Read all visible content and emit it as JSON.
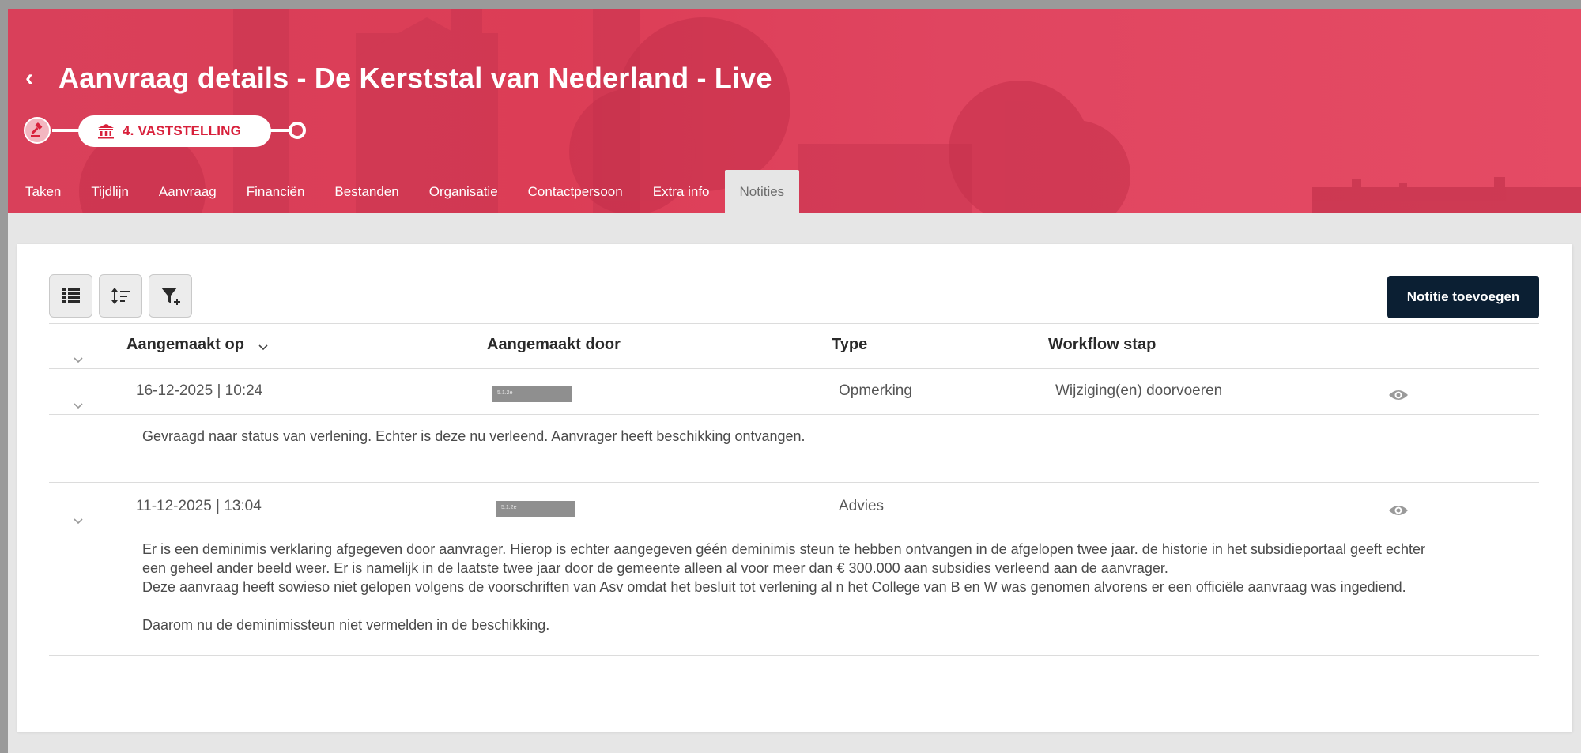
{
  "header": {
    "title": "Aanvraag details - De Kerststal van Nederland - Live",
    "stepper": {
      "current_step_label": "4. VASTSTELLING"
    },
    "tabs": [
      {
        "label": "Taken",
        "active": false
      },
      {
        "label": "Tijdlijn",
        "active": false
      },
      {
        "label": "Aanvraag",
        "active": false
      },
      {
        "label": "Financiën",
        "active": false
      },
      {
        "label": "Bestanden",
        "active": false
      },
      {
        "label": "Organisatie",
        "active": false
      },
      {
        "label": "Contactpersoon",
        "active": false
      },
      {
        "label": "Extra info",
        "active": false
      },
      {
        "label": "Notities",
        "active": true
      }
    ]
  },
  "toolbar": {
    "add_note_label": "Notitie toevoegen",
    "icons": [
      "list-view-icon",
      "sort-icon",
      "filter-add-icon"
    ]
  },
  "table": {
    "columns": [
      "Aangemaakt op",
      "Aangemaakt door",
      "Type",
      "Workflow stap"
    ],
    "rows": [
      {
        "created_on": "16-12-2025 | 10:24",
        "created_by_redacted": "5.1.2e",
        "type": "Opmerking",
        "workflow_step": "Wijziging(en) doorvoeren",
        "note": [
          "Gevraagd naar status van verlening. Echter is deze nu verleend. Aanvrager heeft beschikking ontvangen."
        ]
      },
      {
        "created_on": "11-12-2025 | 13:04",
        "created_by_redacted": "5.1.2e",
        "type": "Advies",
        "workflow_step": "",
        "note": [
          "Er is een deminimis verklaring afgegeven door aanvrager. Hierop is echter aangegeven géén deminimis steun te hebben ontvangen in de afgelopen twee jaar. de historie in het subsidieportaal geeft echter",
          "een geheel ander beeld weer. Er is namelijk in de laatste twee jaar door de gemeente alleen al voor meer dan € 300.000 aan subsidies verleend aan de aanvrager.",
          "Deze aanvraag heeft sowieso niet gelopen volgens de voorschriften van Asv omdat het besluit tot verlening al n het College van B en W was genomen alvorens er een officiële aanvraag was ingediend.",
          "",
          "Daarom nu de deminimissteun niet vermelden in de beschikking."
        ]
      }
    ]
  },
  "colors": {
    "brand_red": "#d8203b",
    "header_gradient_start": "#d9405a",
    "primary_button": "#0b1f33"
  }
}
